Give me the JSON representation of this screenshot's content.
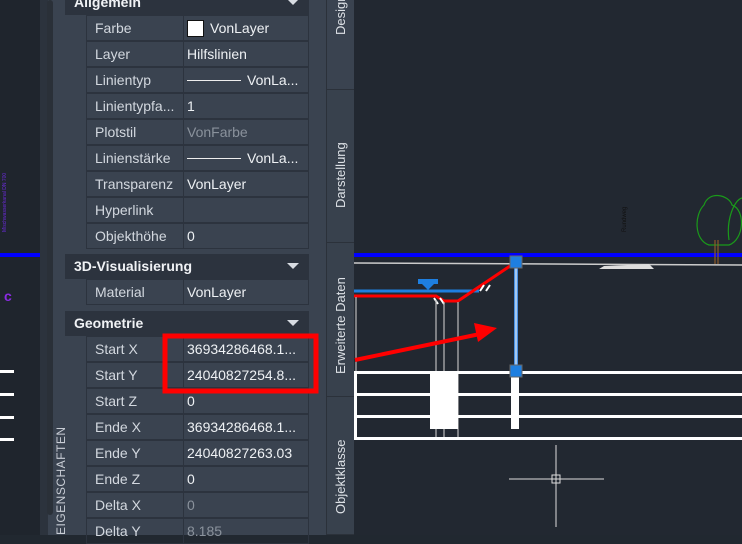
{
  "side_label": "EIGENSCHAFTEN",
  "sections": [
    {
      "title": "Allgemein",
      "rows": [
        {
          "label": "Farbe",
          "value": "VonLayer",
          "swatch": "#ffffff"
        },
        {
          "label": "Layer",
          "value": "Hilfslinien"
        },
        {
          "label": "Linientyp",
          "value": "VonLa..."
        },
        {
          "label": "Linientypfa...",
          "value": "1"
        },
        {
          "label": "Plotstil",
          "value": "VonFarbe"
        },
        {
          "label": "Linienstärke",
          "value": "VonLa..."
        },
        {
          "label": "Transparenz",
          "value": "VonLayer"
        },
        {
          "label": "Hyperlink",
          "value": ""
        },
        {
          "label": "Objekthöhe",
          "value": "0"
        }
      ]
    },
    {
      "title": "3D-Visualisierung",
      "rows": [
        {
          "label": "Material",
          "value": "VonLayer"
        }
      ]
    },
    {
      "title": "Geometrie",
      "rows": [
        {
          "label": "Start X",
          "value": "36934286468.1..."
        },
        {
          "label": "Start Y",
          "value": "24040827254.8..."
        },
        {
          "label": "Start Z",
          "value": "0"
        },
        {
          "label": "Ende X",
          "value": "36934286468.1..."
        },
        {
          "label": "Ende Y",
          "value": "24040827263.03"
        },
        {
          "label": "Ende Z",
          "value": "0"
        },
        {
          "label": "Delta X",
          "value": "0"
        },
        {
          "label": "Delta Y",
          "value": "8.185"
        }
      ]
    }
  ],
  "tabs": [
    "Design",
    "Darstellung",
    "Erweiterte Daten",
    "Objektklasse"
  ],
  "drawing": {
    "left_text": "Mischwasserkanal DN 700",
    "road_label": "Rundweg"
  },
  "colors": {
    "highlight": "#ff0000",
    "grip": "#1e7fe0"
  }
}
